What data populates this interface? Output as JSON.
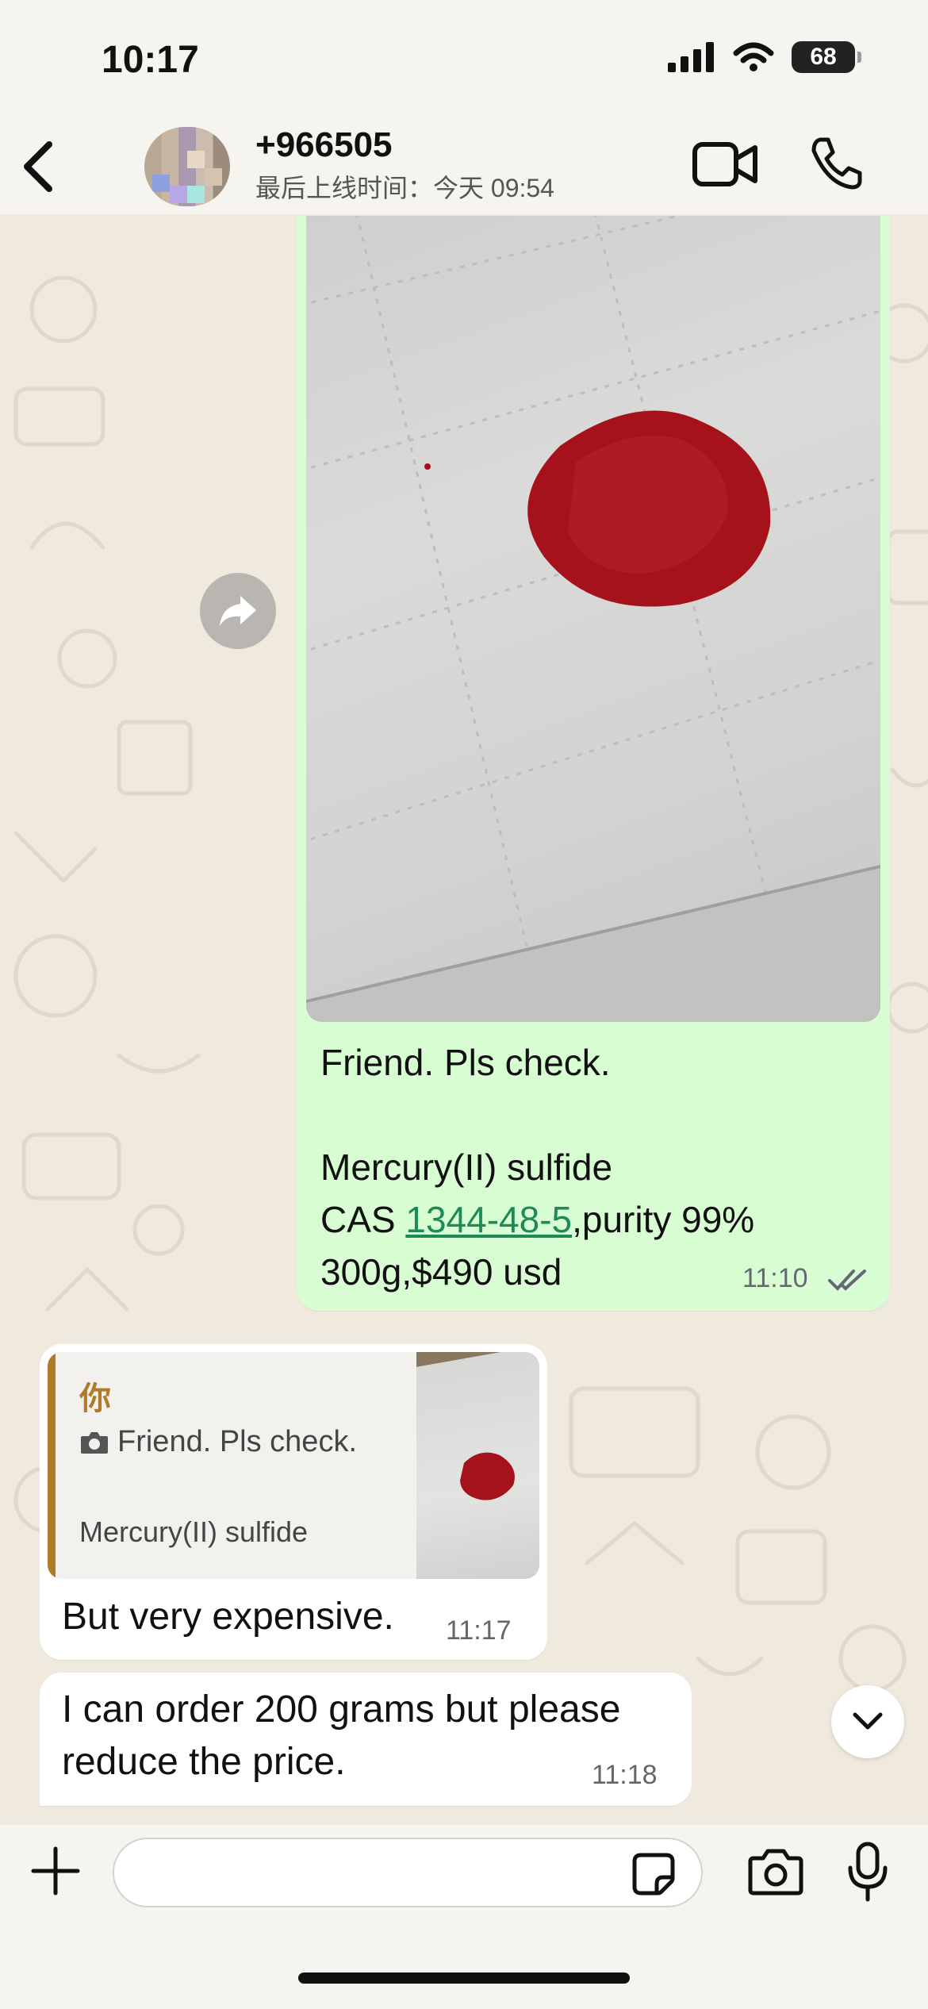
{
  "status_bar": {
    "time": "10:17",
    "battery": "68"
  },
  "header": {
    "contact_name": "+966505",
    "last_seen": "最后上线时间：今天 09:54"
  },
  "messages": {
    "outgoing": {
      "line1": "Friend. Pls check.",
      "line2": "Mercury(II) sulfide",
      "line3_prefix": "CAS ",
      "line3_link": "1344-48-5",
      "line3_suffix": ",purity 99%",
      "line4": "300g,$490 usd",
      "time": "11:10"
    },
    "reply": {
      "quote_author": "你",
      "quote_line1": "Friend. Pls check.",
      "quote_line2": "Mercury(II) sulfide",
      "text": "But very expensive.",
      "time": "11:17"
    },
    "incoming2": {
      "text": "I can order 200 grams but please\nreduce the price.",
      "time": "11:18"
    }
  },
  "colors": {
    "outgoing_bubble": "#d8fdd2",
    "link": "#1f8a58",
    "quote_accent": "#b07a2a",
    "powder": "#a5121c"
  }
}
